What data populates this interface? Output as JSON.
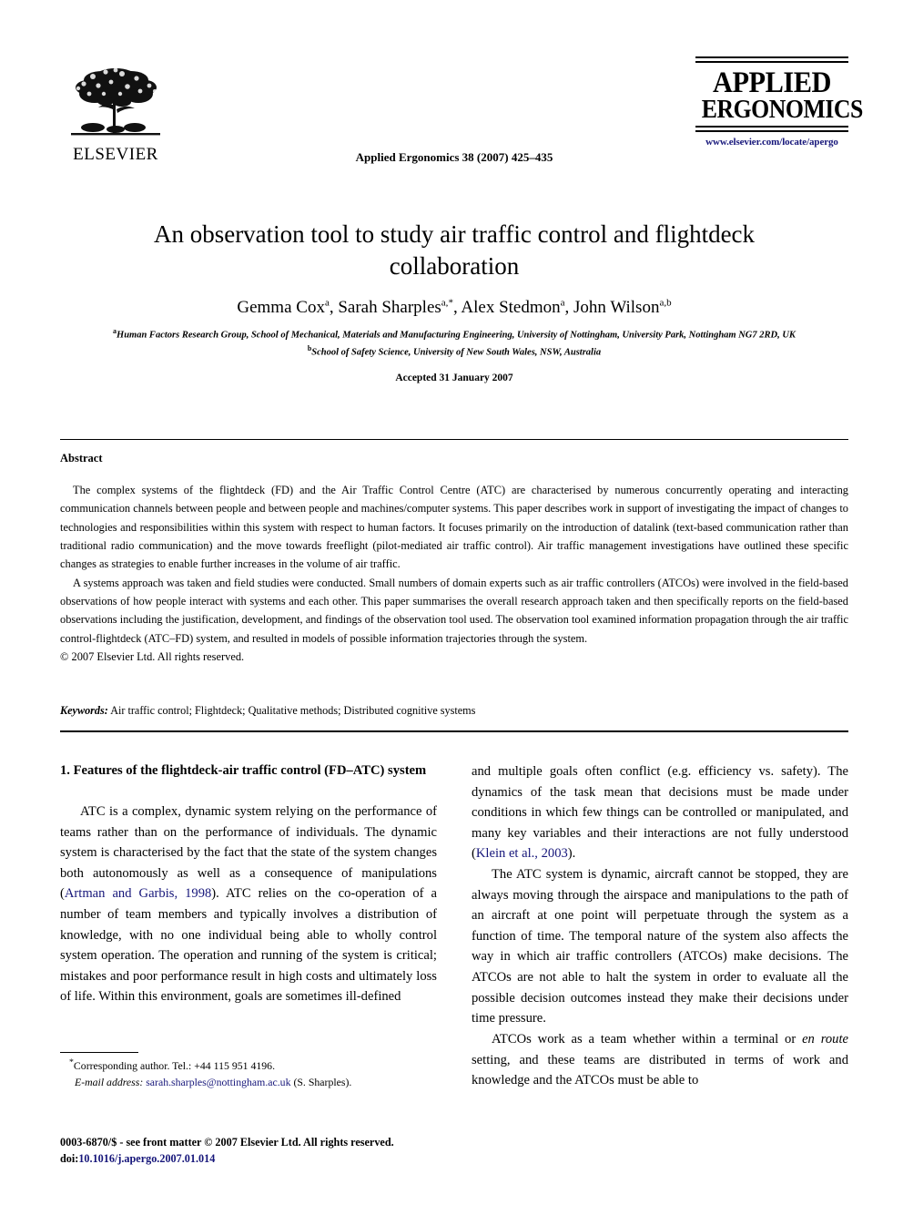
{
  "header": {
    "publisher_name": "ELSEVIER",
    "publisher_logo_icon": "elsevier-tree-logo",
    "journal_citation": "Applied Ergonomics 38 (2007) 425–435",
    "masthead_line1": "APPLIED",
    "masthead_line2": "ERGONOMICS",
    "journal_url": "www.elsevier.com/locate/apergo",
    "url_color": "#16167a"
  },
  "title_block": {
    "title": "An observation tool to study air traffic control and flightdeck collaboration",
    "authors_html": "Gemma Cox<sup>a</sup>, Sarah Sharples<sup>a,</sup><sup>*</sup>, Alex Stedmon<sup>a</sup>, John Wilson<sup>a,b</sup>",
    "affiliation_a": "Human Factors Research Group, School of Mechanical, Materials and Manufacturing Engineering, University of Nottingham, University Park, Nottingham NG7 2RD, UK",
    "affiliation_a_marker": "a",
    "affiliation_b": "School of Safety Science, University of New South Wales, NSW, Australia",
    "affiliation_b_marker": "b",
    "accepted": "Accepted 31 January 2007"
  },
  "abstract": {
    "heading": "Abstract",
    "paragraph1": "The complex systems of the flightdeck (FD) and the Air Traffic Control Centre (ATC) are characterised by numerous concurrently operating and interacting communication channels between people and between people and machines/computer systems. This paper describes work in support of investigating the impact of changes to technologies and responsibilities within this system with respect to human factors. It focuses primarily on the introduction of datalink (text-based communication rather than traditional radio communication) and the move towards freeflight (pilot-mediated air traffic control). Air traffic management investigations have outlined these specific changes as strategies to enable further increases in the volume of air traffic.",
    "paragraph2": "A systems approach was taken and field studies were conducted. Small numbers of domain experts such as air traffic controllers (ATCOs) were involved in the field-based observations of how people interact with systems and each other. This paper summarises the overall research approach taken and then specifically reports on the field-based observations including the justification, development, and findings of the observation tool used. The observation tool examined information propagation through the air traffic control-flightdeck (ATC–FD) system, and resulted in models of possible information trajectories through the system.",
    "copyright": "© 2007 Elsevier Ltd. All rights reserved.",
    "keywords_label": "Keywords:",
    "keywords_value": "Air traffic control; Flightdeck; Qualitative methods; Distributed cognitive systems"
  },
  "body": {
    "section_heading": "1. Features of the flightdeck-air traffic control (FD–ATC) system",
    "left_paragraph1_part1": "ATC is a complex, dynamic system relying on the performance of teams rather than on the performance of individuals. The dynamic system is characterised by the fact that the state of the system changes both autonomously as well as a consequence of manipulations (",
    "left_paragraph1_ref1": "Artman and Garbis, 1998",
    "left_paragraph1_part2": "). ATC relies on the co-operation of a number of team members and typically involves a distribution of knowledge, with no one individual being able to wholly control system operation. The operation and running of the system is critical; mistakes and poor performance result in high costs and ultimately loss of life. Within this environment, goals are sometimes ill-defined",
    "right_paragraph1_part1": "and multiple goals often conflict (e.g. efficiency vs. safety). The dynamics of the task mean that decisions must be made under conditions in which few things can be controlled or manipulated, and many key variables and their interactions are not fully understood (",
    "right_paragraph1_ref1": "Klein et al., 2003",
    "right_paragraph1_part2": ").",
    "right_paragraph2": "The ATC system is dynamic, aircraft cannot be stopped, they are always moving through the airspace and manipulations to the path of an aircraft at one point will perpetuate through the system as a function of time. The temporal nature of the system also affects the way in which air traffic controllers (ATCOs) make decisions. The ATCOs are not able to halt the system in order to evaluate all the possible decision outcomes instead they make their decisions under time pressure.",
    "right_paragraph3_part1": "ATCOs work as a team whether within a terminal or ",
    "right_paragraph3_italic": "en route",
    "right_paragraph3_part2": " setting, and these teams are distributed in terms of work and knowledge and the ATCOs must be able to"
  },
  "footnotes": {
    "corresponding_marker": "*",
    "corresponding_author": "Corresponding author. Tel.: +44 115 951 4196.",
    "email_label": "E-mail address:",
    "email_address": "sarah.sharples@nottingham.ac.uk",
    "email_suffix": "(S. Sharples).",
    "issn_line": "0003-6870/$ - see front matter © 2007 Elsevier Ltd. All rights reserved.",
    "doi_label": "doi:",
    "doi_value": "10.1016/j.apergo.2007.01.014",
    "link_color": "#16167a"
  }
}
